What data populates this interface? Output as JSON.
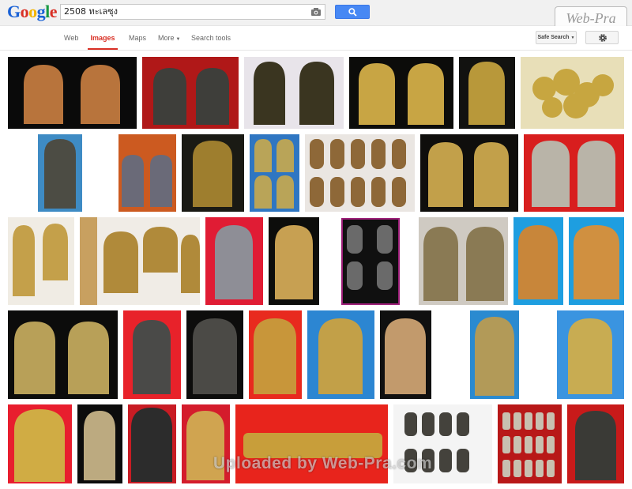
{
  "header": {
    "logo_text": "Google",
    "search": {
      "value": "2508 ทะเลซุง"
    },
    "icons": {
      "camera": "camera-icon",
      "search": "search-icon"
    }
  },
  "site_logo": "Web-Pra",
  "nav": {
    "tabs": [
      {
        "label": "Web",
        "active": false
      },
      {
        "label": "Images",
        "active": true
      },
      {
        "label": "Maps",
        "active": false
      },
      {
        "label": "More",
        "active": false
      },
      {
        "label": "Search tools",
        "active": false
      }
    ],
    "safe_search": "Safe Search",
    "settings_icon": "gear-icon"
  },
  "colors": {
    "accent_red": "#d93025",
    "search_blue": "#4788f4"
  },
  "watermark": "Uploaded by Web-Pra.com",
  "results_description_note": null
}
